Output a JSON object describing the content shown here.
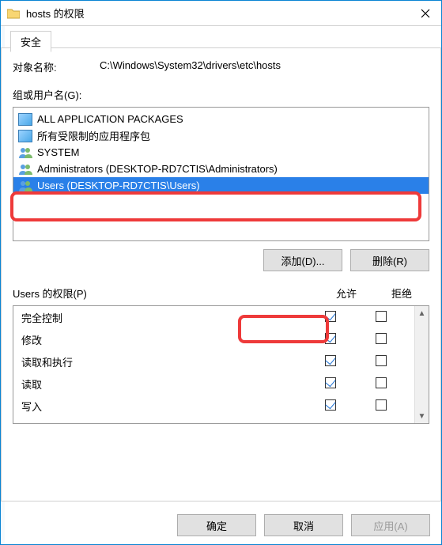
{
  "window": {
    "title": "hosts 的权限"
  },
  "tabs": {
    "security": "安全"
  },
  "object": {
    "label": "对象名称:",
    "path": "C:\\Windows\\System32\\drivers\\etc\\hosts"
  },
  "groups_label": "组或用户名(G):",
  "principals": [
    {
      "name": "ALL APPLICATION PACKAGES",
      "icon": "pkg",
      "selected": false
    },
    {
      "name": "所有受限制的应用程序包",
      "icon": "pkg",
      "selected": false
    },
    {
      "name": "SYSTEM",
      "icon": "users",
      "selected": false
    },
    {
      "name": "Administrators (DESKTOP-RD7CTIS\\Administrators)",
      "icon": "users",
      "selected": false
    },
    {
      "name": "Users (DESKTOP-RD7CTIS\\Users)",
      "icon": "users",
      "selected": true
    }
  ],
  "buttons": {
    "add": "添加(D)...",
    "remove": "删除(R)",
    "ok": "确定",
    "cancel": "取消",
    "apply": "应用(A)"
  },
  "perm_header": {
    "title": "Users 的权限(P)",
    "allow": "允许",
    "deny": "拒绝"
  },
  "permissions": [
    {
      "name": "完全控制",
      "allow": true,
      "deny": false
    },
    {
      "name": "修改",
      "allow": true,
      "deny": false
    },
    {
      "name": "读取和执行",
      "allow": true,
      "deny": false
    },
    {
      "name": "读取",
      "allow": true,
      "deny": false
    },
    {
      "name": "写入",
      "allow": true,
      "deny": false
    }
  ]
}
